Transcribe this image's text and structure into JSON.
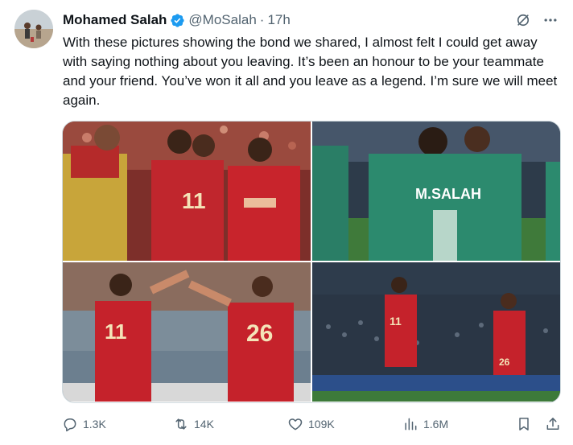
{
  "tweet": {
    "author_name": "Mohamed Salah",
    "handle": "@MoSalah",
    "separator": "·",
    "time": "17h",
    "text": "With these pictures showing the bond we shared, I almost felt I could get away with saying nothing about you leaving. It’s been an honour to be your teammate and your friend. You’ve won it all and you leave as a legend. I’m sure we will meet again.",
    "verified_color": "#1d9bf0",
    "icons": {
      "verified": "verified-badge-icon",
      "grok": "grok-icon",
      "more": "more-icon"
    }
  },
  "media": {
    "photos": [
      {
        "name": "photo-teammates-hug",
        "shirt_text_1": "11"
      },
      {
        "name": "photo-green-kit-embrace",
        "shirt_text_1": "M.SALAH"
      },
      {
        "name": "photo-high-five",
        "shirt_text_1": "11",
        "shirt_text_2": "26"
      },
      {
        "name": "photo-stadium-celebration",
        "shirt_text_1": "11",
        "shirt_text_2": "26"
      }
    ]
  },
  "actions": {
    "reply": {
      "icon": "reply-icon",
      "count": "1.3K"
    },
    "retweet": {
      "icon": "retweet-icon",
      "count": "14K"
    },
    "like": {
      "icon": "heart-icon",
      "count": "109K"
    },
    "views": {
      "icon": "views-icon",
      "count": "1.6M"
    },
    "bookmark": {
      "icon": "bookmark-icon"
    },
    "share": {
      "icon": "share-icon"
    }
  }
}
